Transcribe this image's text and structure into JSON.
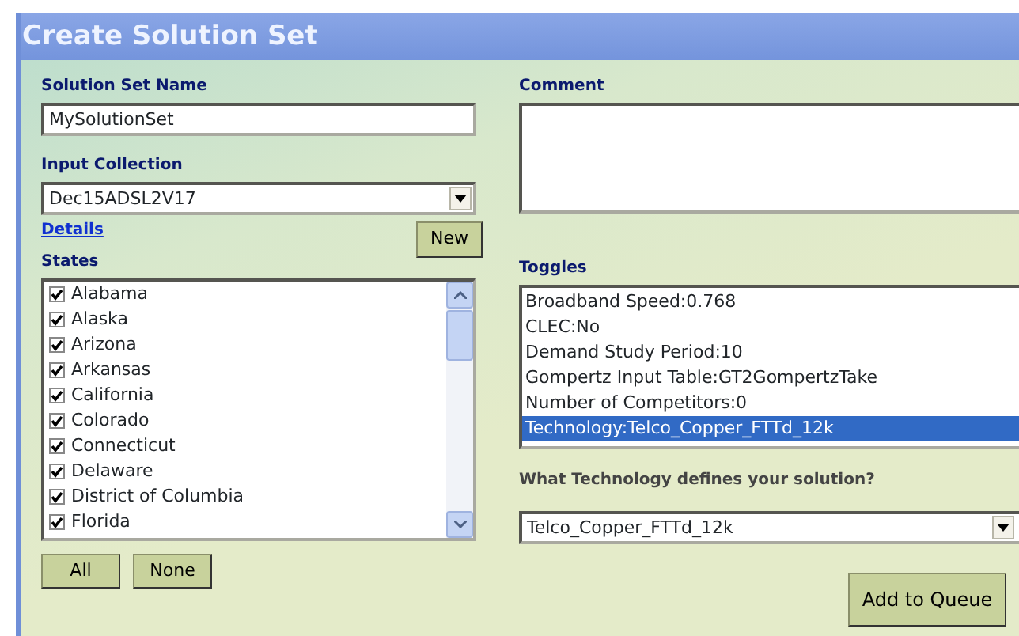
{
  "window": {
    "title": "Create Solution Set"
  },
  "solution_set_name": {
    "label": "Solution Set Name",
    "value": "MySolutionSet"
  },
  "input_collection": {
    "label": "Input Collection",
    "value": "Dec15ADSL2V17",
    "details_link": "Details",
    "new_button": "New"
  },
  "comment": {
    "label": "Comment"
  },
  "states": {
    "label": "States",
    "items": [
      {
        "name": "Alabama",
        "checked": true
      },
      {
        "name": "Alaska",
        "checked": true
      },
      {
        "name": "Arizona",
        "checked": true
      },
      {
        "name": "Arkansas",
        "checked": true
      },
      {
        "name": "California",
        "checked": true
      },
      {
        "name": "Colorado",
        "checked": true
      },
      {
        "name": "Connecticut",
        "checked": true
      },
      {
        "name": "Delaware",
        "checked": true
      },
      {
        "name": "District of Columbia",
        "checked": true
      },
      {
        "name": "Florida",
        "checked": true
      }
    ],
    "buttons": [
      "All",
      "None"
    ]
  },
  "toggles": {
    "label": "Toggles",
    "items": [
      {
        "text": "Broadband Speed:0.768",
        "selected": false
      },
      {
        "text": "CLEC:No",
        "selected": false
      },
      {
        "text": "Demand Study Period:10",
        "selected": false
      },
      {
        "text": "Gompertz Input Table:GT2GompertzTake",
        "selected": false
      },
      {
        "text": "Number of Competitors:0",
        "selected": false
      },
      {
        "text": "Technology:Telco_Copper_FTTd_12k",
        "selected": true
      }
    ]
  },
  "technology": {
    "question": "What Technology defines your solution?",
    "value": "Telco_Copper_FTTd_12k"
  },
  "add_button": "Add to Queue"
}
